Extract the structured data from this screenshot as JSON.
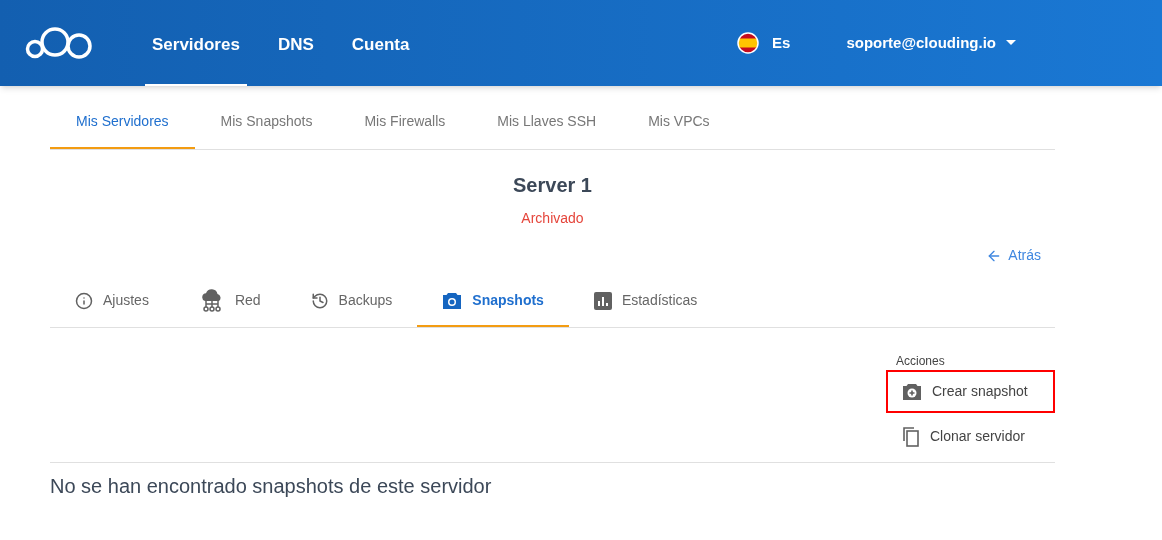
{
  "header": {
    "nav": [
      {
        "label": "Servidores",
        "selected": true
      },
      {
        "label": "DNS",
        "selected": false
      },
      {
        "label": "Cuenta",
        "selected": false
      }
    ],
    "language": "Es",
    "account": "soporte@clouding.io"
  },
  "subnav": [
    {
      "label": "Mis Servidores",
      "selected": true
    },
    {
      "label": "Mis Snapshots",
      "selected": false
    },
    {
      "label": "Mis Firewalls",
      "selected": false
    },
    {
      "label": "Mis Llaves SSH",
      "selected": false
    },
    {
      "label": "Mis VPCs",
      "selected": false
    }
  ],
  "server": {
    "name": "Server 1",
    "status": "Archivado"
  },
  "back_link": "Atrás",
  "tabs": [
    {
      "label": "Ajustes",
      "selected": false
    },
    {
      "label": "Red",
      "selected": false
    },
    {
      "label": "Backups",
      "selected": false
    },
    {
      "label": "Snapshots",
      "selected": true
    },
    {
      "label": "Estadísticas",
      "selected": false
    }
  ],
  "actions": {
    "title": "Acciones",
    "items": [
      {
        "label": "Crear snapshot",
        "highlighted": true
      },
      {
        "label": "Clonar servidor",
        "highlighted": false
      }
    ]
  },
  "empty_message": "No se han encontrado snapshots de este servidor"
}
